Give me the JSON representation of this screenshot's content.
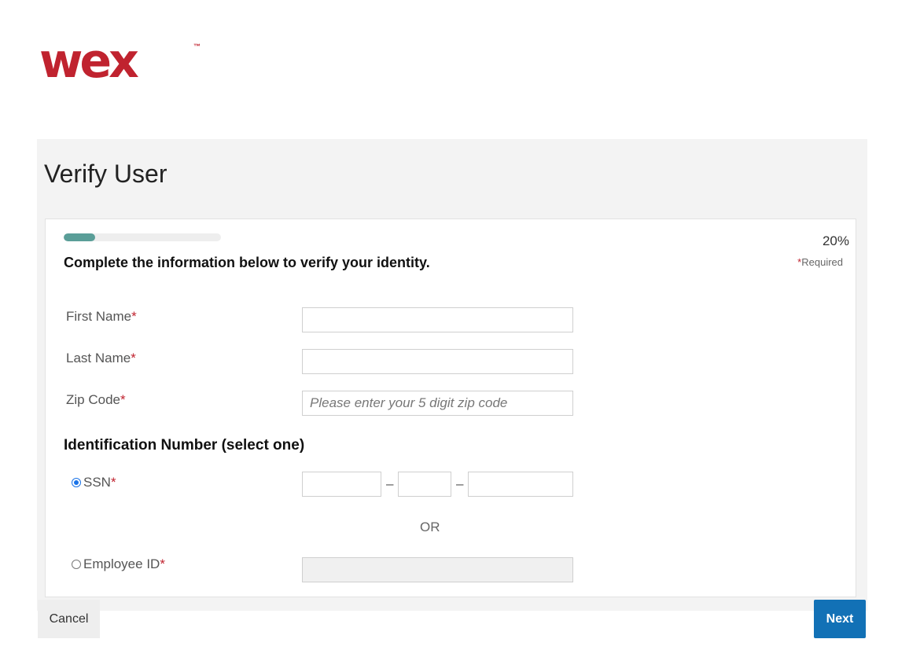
{
  "brand": {
    "logo_text": "wex",
    "trademark": "™",
    "color": "#c0232f"
  },
  "page": {
    "title": "Verify User"
  },
  "progress": {
    "percent_label": "20%",
    "fraction": 0.2,
    "color": "#5a9e98"
  },
  "required_note": {
    "star": "*",
    "text": "Required"
  },
  "intro_text": "Complete the information below to verify your identity.",
  "fields": {
    "first_name": {
      "label": "First Name",
      "value": "",
      "placeholder": ""
    },
    "last_name": {
      "label": "Last Name",
      "value": "",
      "placeholder": ""
    },
    "zip_code": {
      "label": "Zip Code",
      "value": "",
      "placeholder": "Please enter your 5 digit zip code"
    }
  },
  "required_star": "*",
  "identification": {
    "heading": "Identification Number (select one)",
    "ssn": {
      "label": "SSN",
      "selected": true,
      "separator": "–"
    },
    "or_text": "OR",
    "employee_id": {
      "label": "Employee ID",
      "selected": false
    }
  },
  "buttons": {
    "cancel": "Cancel",
    "next": "Next",
    "next_color": "#1271b6"
  }
}
